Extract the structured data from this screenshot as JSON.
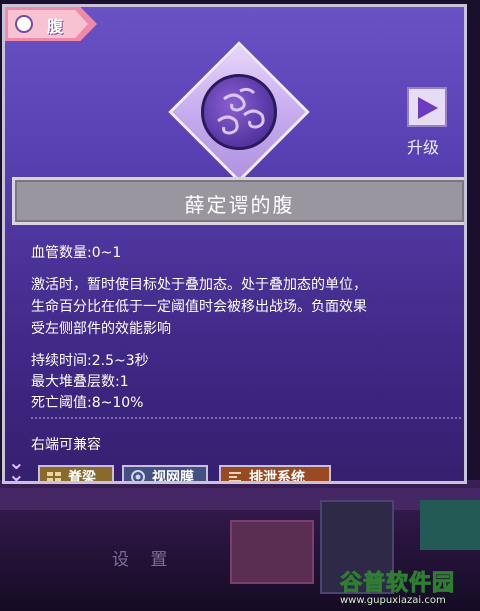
{
  "background": {
    "settings_label": "设 置"
  },
  "watermark": {
    "title": "谷普软件园",
    "url": "www.gupuxiazai.com"
  },
  "card": {
    "tag_label": "腹",
    "upgrade_label": "升级",
    "name": "薛定谔的腹",
    "vessel_count": "血管数量:0~1",
    "description": [
      "激活时，暂时使目标处于叠加态。处于叠加态的单位，",
      "生命百分比在低于一定阈值时会被移出战场。负面效果",
      "受左侧部件的效能影响"
    ],
    "stats": [
      "持续时间:2.5~3秒",
      "最大堆叠层数:1",
      "死亡阈值:8~10%"
    ],
    "compat_label": "右端可兼容",
    "compat_items": [
      {
        "label": "脊梁",
        "icon": "spine-icon",
        "color": "#8a6a2c"
      },
      {
        "label": "视网膜",
        "icon": "retina-icon",
        "color": "#444f82"
      },
      {
        "label": "排泄系统",
        "icon": "excretion-icon",
        "color": "#9a4a22"
      }
    ]
  }
}
